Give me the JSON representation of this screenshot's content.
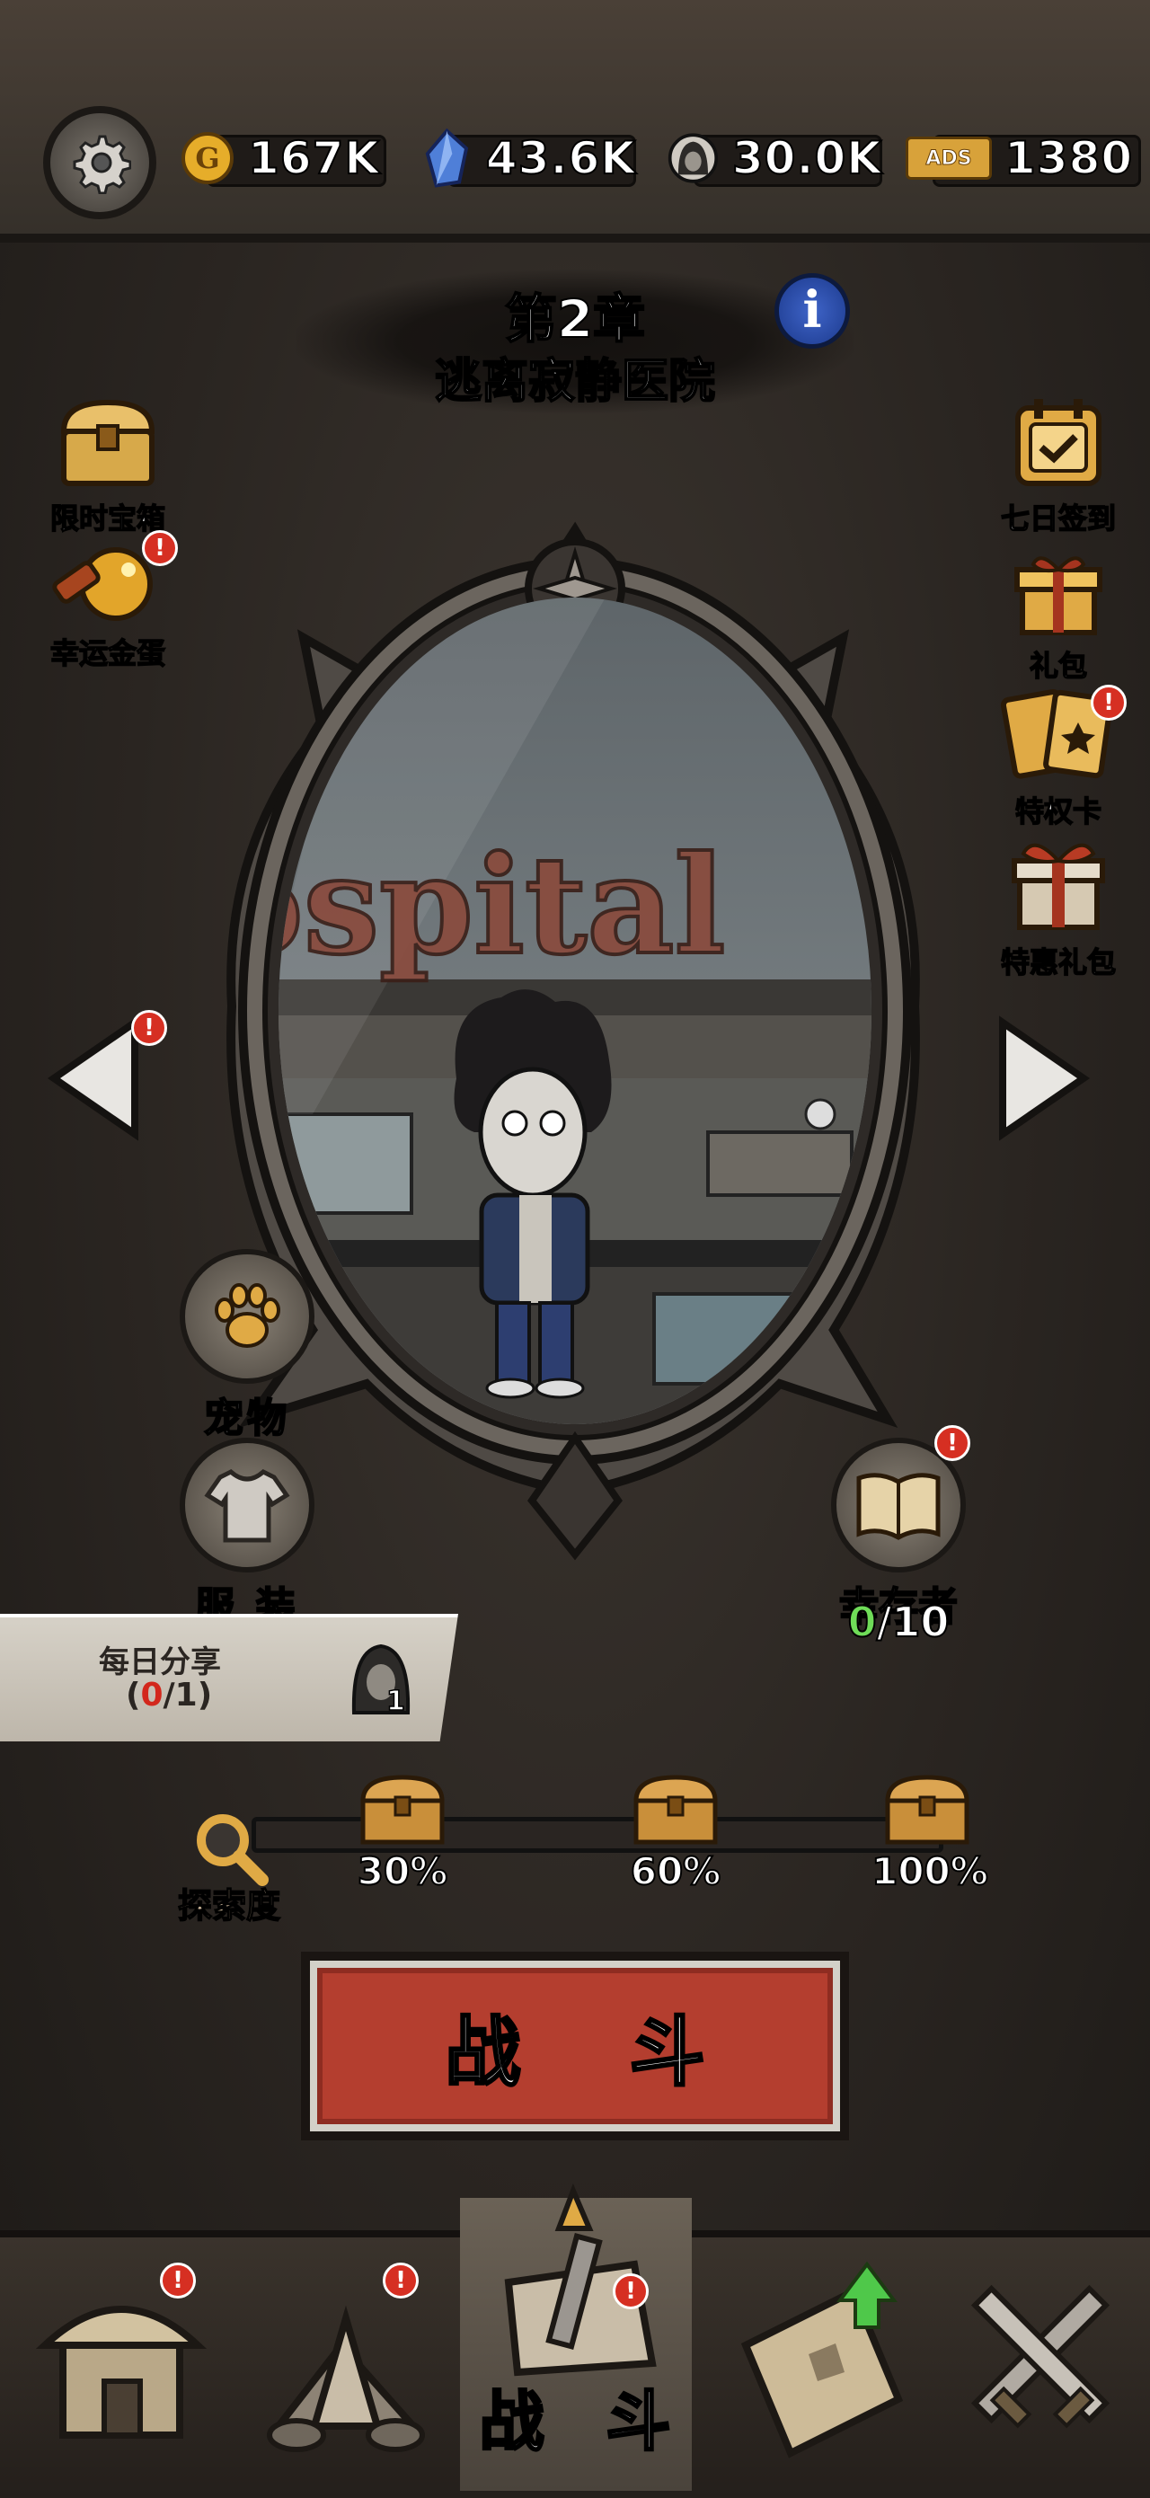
{
  "currencies": {
    "gold": "167K",
    "crystal": "43.6K",
    "token": "30.0K",
    "ads_label": "ADS",
    "ads": "1380"
  },
  "chapter": {
    "number": "第2章",
    "name": "逃离寂静医院"
  },
  "left_menu": {
    "timed_chest": "限时宝箱",
    "lucky_egg": "幸运金蛋"
  },
  "right_menu": {
    "seven_day": "七日签到",
    "gift_pack": "礼包",
    "privilege_card": "特权卡",
    "special_gift": "特惠礼包"
  },
  "scene": {
    "sign_text": "hospital"
  },
  "actions": {
    "pet": "宠物",
    "outfit": "服 装",
    "survivor": "幸存者",
    "survivor_current": "0",
    "survivor_total": "/10"
  },
  "daily_share": {
    "title": "每日分享",
    "open": "(",
    "done": "0",
    "rest": "/1)",
    "reward_count": "1"
  },
  "exploration": {
    "label": "探索度",
    "milestones": [
      "30%",
      "60%",
      "100%"
    ],
    "progress": 0
  },
  "fight_button": "战 斗",
  "bottom_nav": {
    "active_label": "战 斗"
  },
  "badge": "!"
}
